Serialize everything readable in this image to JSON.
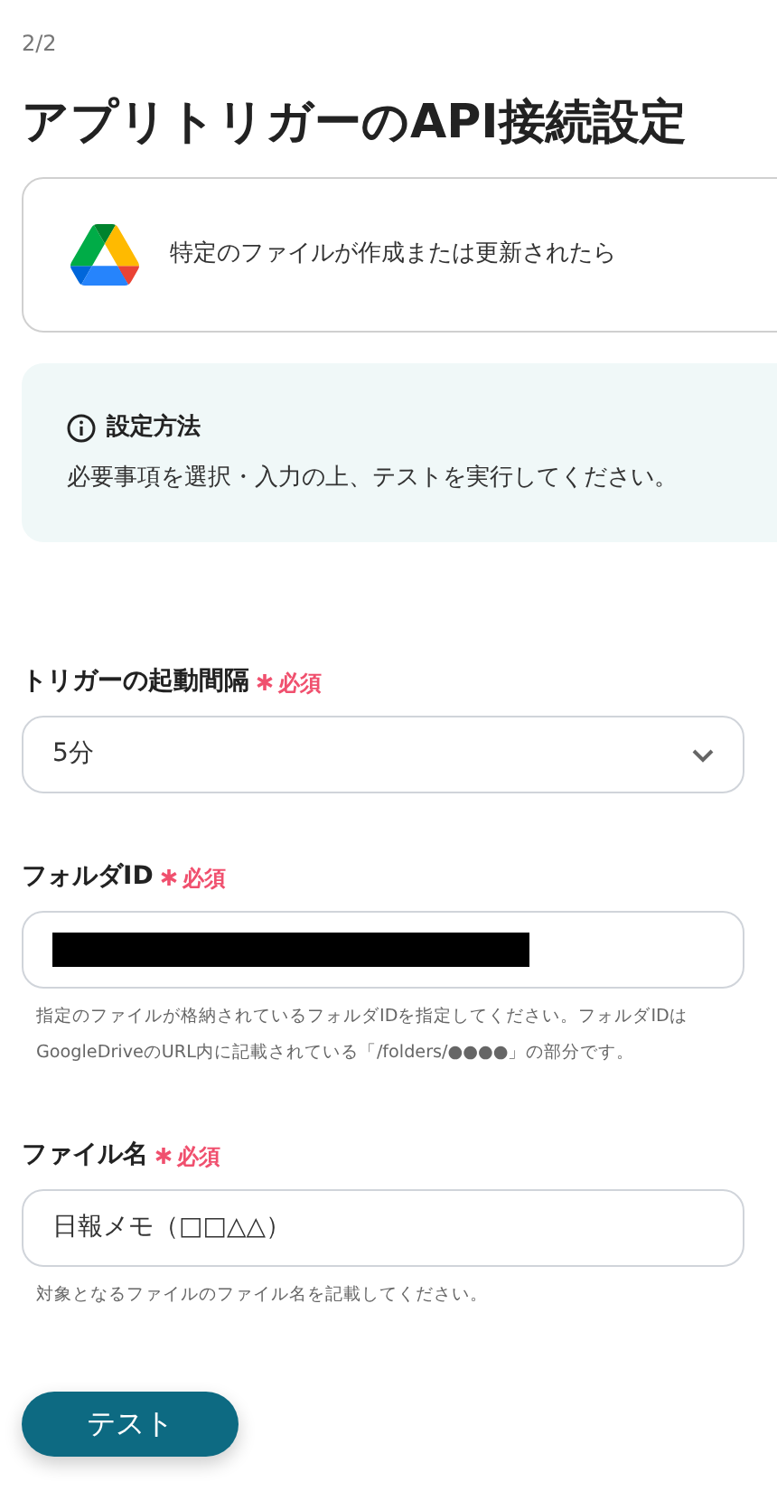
{
  "step": "2/2",
  "title": "アプリトリガーのAPI接続設定",
  "trigger_card": {
    "label": "特定のファイルが作成または更新されたら"
  },
  "info": {
    "heading": "設定方法",
    "text": "必要事項を選択・入力の上、テストを実行してください。"
  },
  "fields": [
    {
      "kind": "select",
      "label": "トリガーの起動間隔",
      "required": true,
      "required_label": "必須",
      "value": "5分"
    },
    {
      "kind": "text",
      "label": "フォルダID",
      "required": true,
      "required_label": "必須",
      "value_redacted": true,
      "hint": "指定のファイルが格納されているフォルダIDを指定してください。フォルダIDはGoogleDriveのURL内に記載されている「/folders/●●●●」の部分です。"
    },
    {
      "kind": "text",
      "label": "ファイル名",
      "required": true,
      "required_label": "必須",
      "value": "日報メモ（□□△△）",
      "hint": "対象となるファイルのファイル名を記載してください。"
    }
  ],
  "test_button": "テスト"
}
